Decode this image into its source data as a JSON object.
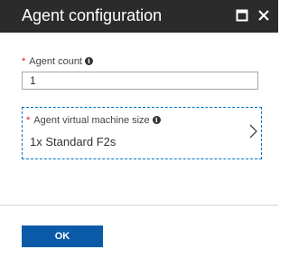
{
  "header": {
    "title": "Agent configuration"
  },
  "form": {
    "agent_count": {
      "required_mark": "*",
      "label": "Agent count",
      "info_glyph": "i",
      "value": "1"
    },
    "vm_size": {
      "required_mark": "*",
      "label": "Agent virtual machine size",
      "info_glyph": "i",
      "value": "1x Standard F2s"
    }
  },
  "footer": {
    "ok_label": "OK"
  },
  "icons": {
    "maximize": "maximize-icon",
    "close": "close-icon",
    "info": "info-icon",
    "chevron": "chevron-right-icon"
  },
  "colors": {
    "header_bg": "#2b2b2b",
    "required": "#e81123",
    "accent": "#0072c6",
    "button_bg": "#0b5aa8"
  }
}
